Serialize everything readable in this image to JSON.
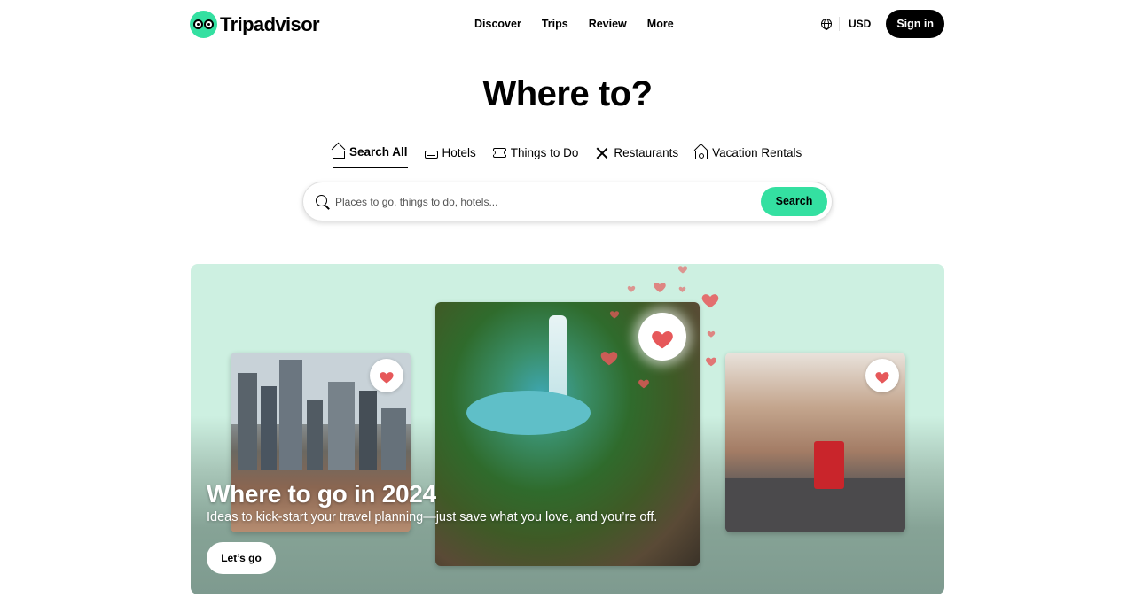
{
  "header": {
    "logo_text": "Tripadvisor",
    "nav": [
      "Discover",
      "Trips",
      "Review",
      "More"
    ],
    "currency": "USD",
    "signin_label": "Sign in"
  },
  "hero": {
    "title": "Where to?",
    "tabs": [
      {
        "label": "Search All",
        "icon": "home-icon"
      },
      {
        "label": "Hotels",
        "icon": "bed-icon"
      },
      {
        "label": "Things to Do",
        "icon": "ticket-icon"
      },
      {
        "label": "Restaurants",
        "icon": "fork-knife-icon"
      },
      {
        "label": "Vacation Rentals",
        "icon": "house-key-icon"
      }
    ],
    "active_tab": "Search All",
    "search": {
      "placeholder": "Places to go, things to do, hotels...",
      "value": "",
      "button_label": "Search"
    }
  },
  "promo": {
    "title": "Where to go in 2024",
    "subtitle": "Ideas to kick-start your travel planning—just save what you love, and you’re off.",
    "button_label": "Let’s go",
    "images": [
      {
        "name": "city-skyline-photo",
        "icon": "heart-icon"
      },
      {
        "name": "waterfall-jungle-photo",
        "icon": "heart-icon"
      },
      {
        "name": "london-street-photo",
        "icon": "heart-icon"
      }
    ]
  },
  "colors": {
    "brand_green": "#34e0a1",
    "promo_mint": "#cdf0e1",
    "heart_red": "#e6585a",
    "signin_bg": "#000000"
  }
}
